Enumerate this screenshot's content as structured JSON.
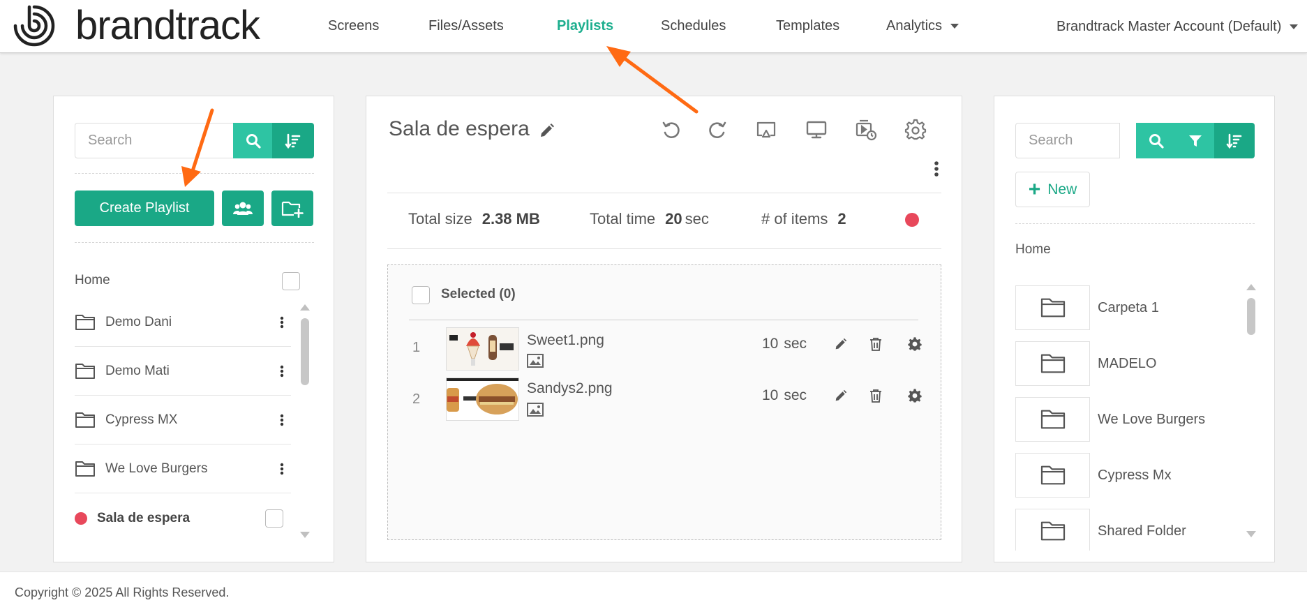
{
  "brand": {
    "name": "brandtrack",
    "accent": "#1aa886",
    "accent_light": "#2ec4a3",
    "alert": "#e8485b",
    "annotation_color": "#ff6a13"
  },
  "nav": {
    "items": [
      {
        "label": "Screens"
      },
      {
        "label": "Files/Assets"
      },
      {
        "label": "Playlists",
        "active": true
      },
      {
        "label": "Schedules"
      },
      {
        "label": "Templates"
      },
      {
        "label": "Analytics",
        "dropdown": true
      }
    ],
    "account": "Brandtrack Master Account (Default)"
  },
  "left": {
    "search_placeholder": "Search",
    "create_label": "Create Playlist",
    "home_label": "Home",
    "folders": [
      "Demo Dani",
      "Demo Mati",
      "Cypress MX",
      "We Love Burgers"
    ],
    "current_playlist": "Sala de espera"
  },
  "center": {
    "title": "Sala de espera",
    "total_size_label": "Total size",
    "total_size_value": "2.38 MB",
    "total_time_label": "Total time",
    "total_time_value": "20",
    "total_time_unit": "sec",
    "items_label": "# of items",
    "items_value": "2",
    "selected_label": "Selected (0)",
    "items": [
      {
        "index": "1",
        "name": "Sweet1.png",
        "duration": "10",
        "unit": "sec"
      },
      {
        "index": "2",
        "name": "Sandys2.png",
        "duration": "10",
        "unit": "sec"
      }
    ]
  },
  "right": {
    "search_placeholder": "Search",
    "new_label": "New",
    "home_label": "Home",
    "folders": [
      "Carpeta 1",
      "MADELO",
      "We Love Burgers",
      "Cypress Mx",
      "Shared Folder"
    ]
  },
  "footer": {
    "copyright": "Copyright © 2025 All Rights Reserved."
  }
}
